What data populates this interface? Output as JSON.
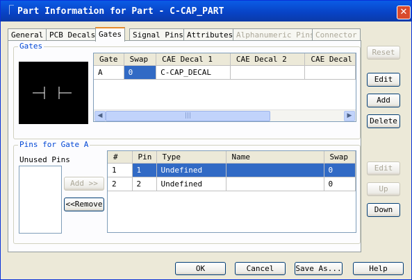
{
  "window": {
    "title": "Part Information for Part - C-CAP_PART",
    "close": "✕"
  },
  "tabs": [
    {
      "label": "General"
    },
    {
      "label": "PCB Decals"
    },
    {
      "label": "Gates"
    },
    {
      "label": "Signal Pins"
    },
    {
      "label": "Attributes"
    },
    {
      "label": "Alphanumeric Pins"
    },
    {
      "label": "Connector"
    }
  ],
  "gates": {
    "group_label": "Gates",
    "columns": [
      "Gate",
      "Swap",
      "CAE Decal 1",
      "CAE Decal 2",
      "CAE Decal"
    ],
    "rows": [
      {
        "gate": "A",
        "swap": "0",
        "decal1": "C-CAP_DECAL",
        "decal2": "",
        "decal3": ""
      }
    ],
    "scroll_thumb_grip": "|||",
    "buttons": {
      "reset": "Reset",
      "edit": "Edit",
      "add": "Add",
      "delete": "Delete"
    }
  },
  "pins": {
    "group_label": "Pins for Gate A",
    "unused_label": "Unused Pins",
    "add_button": "Add >>",
    "remove_button": "<<Remove",
    "columns": [
      "#",
      "Pin",
      "Type",
      "Name",
      "Swap"
    ],
    "rows": [
      {
        "num": "1",
        "pin": "1",
        "type": "Undefined",
        "name": "",
        "swap": "0"
      },
      {
        "num": "2",
        "pin": "2",
        "type": "Undefined",
        "name": "",
        "swap": "0"
      }
    ],
    "buttons": {
      "edit": "Edit",
      "up": "Up",
      "down": "Down"
    }
  },
  "footer": {
    "ok": "OK",
    "cancel": "Cancel",
    "save_as": "Save As...",
    "help": "Help"
  }
}
